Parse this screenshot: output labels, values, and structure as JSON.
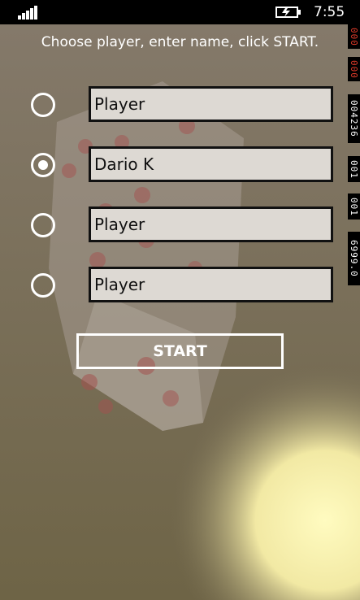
{
  "status": {
    "time": "7:55"
  },
  "app": {
    "instruction": "Choose player, enter name, click START.",
    "players": [
      {
        "name": "Player",
        "selected": false
      },
      {
        "name": "Dario K",
        "selected": true
      },
      {
        "name": "Player",
        "selected": false
      },
      {
        "name": "Player",
        "selected": false
      }
    ],
    "start_label": "START"
  },
  "debug_counters": [
    {
      "text": "000",
      "color": "red"
    },
    {
      "text": "000",
      "color": "red"
    },
    {
      "text": "004236",
      "color": "white"
    },
    {
      "text": "001",
      "color": "white"
    },
    {
      "text": "001",
      "color": "white"
    },
    {
      "text": "6999.0",
      "color": "white"
    }
  ],
  "colors": {
    "background": "#7c7258",
    "input_fill": "#ddd9d3",
    "accent": "#ffffff"
  },
  "icons": {
    "signal": "signal-strength-icon",
    "battery": "battery-charging-icon"
  }
}
